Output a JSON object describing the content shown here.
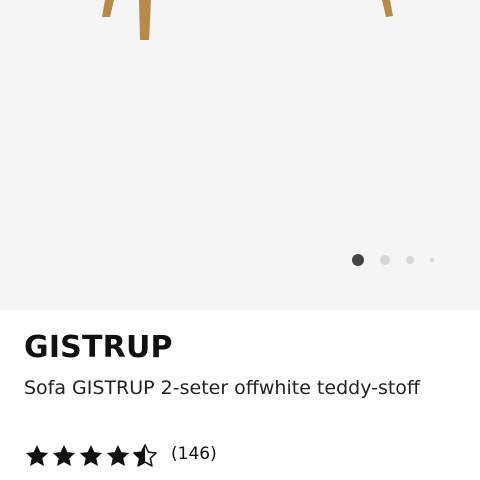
{
  "gallery": {
    "image_alt": "Sofa GISTRUP 2-seter offwhite teddy-stoff",
    "slide_count": 4,
    "active_slide": 1,
    "colors": {
      "background": "#f5f5f5",
      "wood": "#b58a4a",
      "dot_active": "#444444",
      "dot_inactive": "#d6d6d6"
    }
  },
  "product": {
    "name": "GISTRUP",
    "description": "Sofa GISTRUP 2-seter offwhite teddy-stoff",
    "rating": {
      "value": 4.5,
      "max": 5,
      "count_label": "(146)",
      "star_color": "#111111"
    }
  }
}
